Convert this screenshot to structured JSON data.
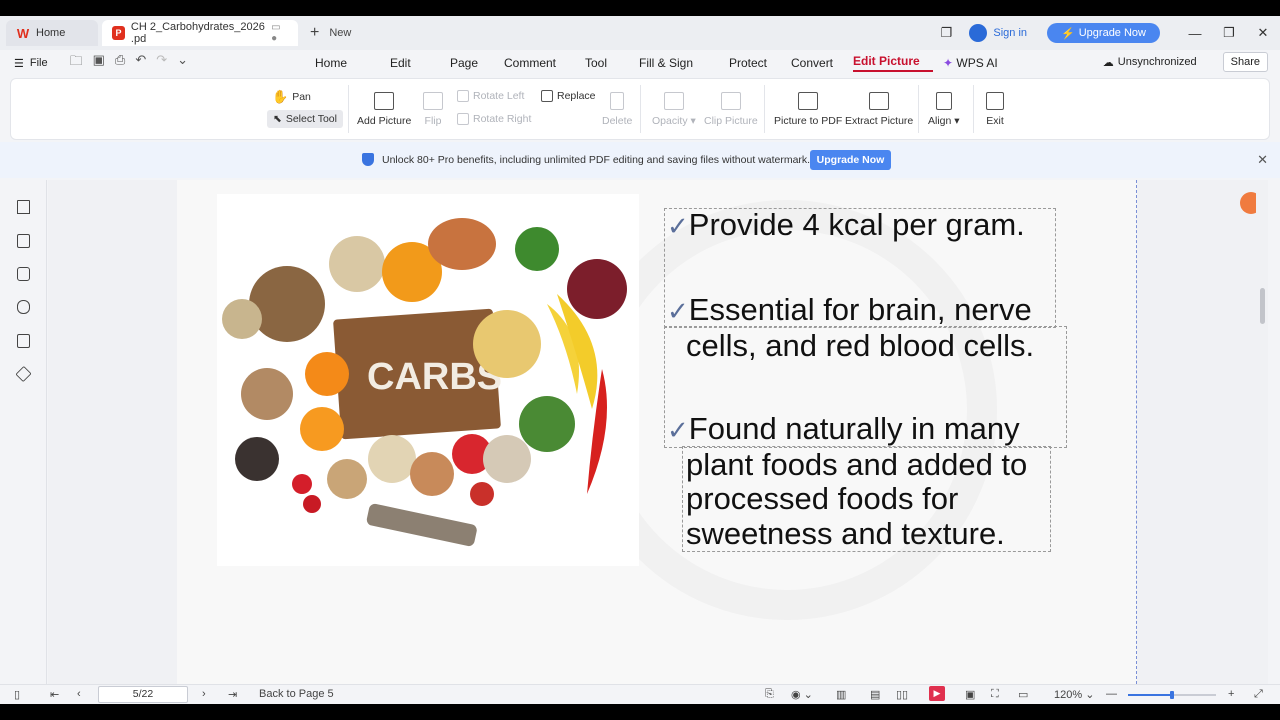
{
  "titlebar": {
    "home_tab": "Home",
    "doc_tab": "CH 2_Carbohydrates_2026 .pd",
    "new_tab": "New",
    "sign_in": "Sign in",
    "upgrade": "Upgrade Now"
  },
  "menubar": {
    "file": "File",
    "menus": [
      "Home",
      "Edit",
      "Page",
      "Comment",
      "Tool",
      "Fill & Sign",
      "Protect",
      "Convert",
      "Edit Picture",
      "WPS AI"
    ],
    "active_menu": "Edit Picture",
    "sync_status": "Unsynchronized",
    "share": "Share"
  },
  "ribbon": {
    "pan": "Pan",
    "select_tool": "Select Tool",
    "add_picture": "Add Picture",
    "flip": "Flip",
    "rotate_left": "Rotate Left",
    "rotate_right": "Rotate Right",
    "replace": "Replace",
    "delete": "Delete",
    "opacity": "Opacity",
    "clip_picture": "Clip Picture",
    "picture_to_pdf": "Picture to PDF",
    "extract_picture": "Extract Picture",
    "align": "Align",
    "exit": "Exit"
  },
  "banner": {
    "text": "Unlock 80+ Pro benefits, including unlimited PDF editing and saving files without watermark.",
    "button": "Upgrade Now"
  },
  "document": {
    "image_label": "CARBS",
    "bullets": [
      {
        "check": "✓",
        "lines": [
          "Provide 4 kcal per gram."
        ]
      },
      {
        "check": "✓",
        "lines": [
          "Essential for brain, nerve",
          "cells, and red blood cells."
        ]
      },
      {
        "check": "✓",
        "lines": [
          "Found naturally in many",
          "plant foods and added to",
          "processed foods for",
          "sweetness and texture."
        ]
      }
    ]
  },
  "statusbar": {
    "page": "5/22",
    "back_to_page": "Back to Page 5",
    "zoom": "120%"
  },
  "colors": {
    "accent_red": "#c8102e",
    "upgrade_blue": "#4a86f0",
    "link_blue": "#2a6ad8"
  }
}
